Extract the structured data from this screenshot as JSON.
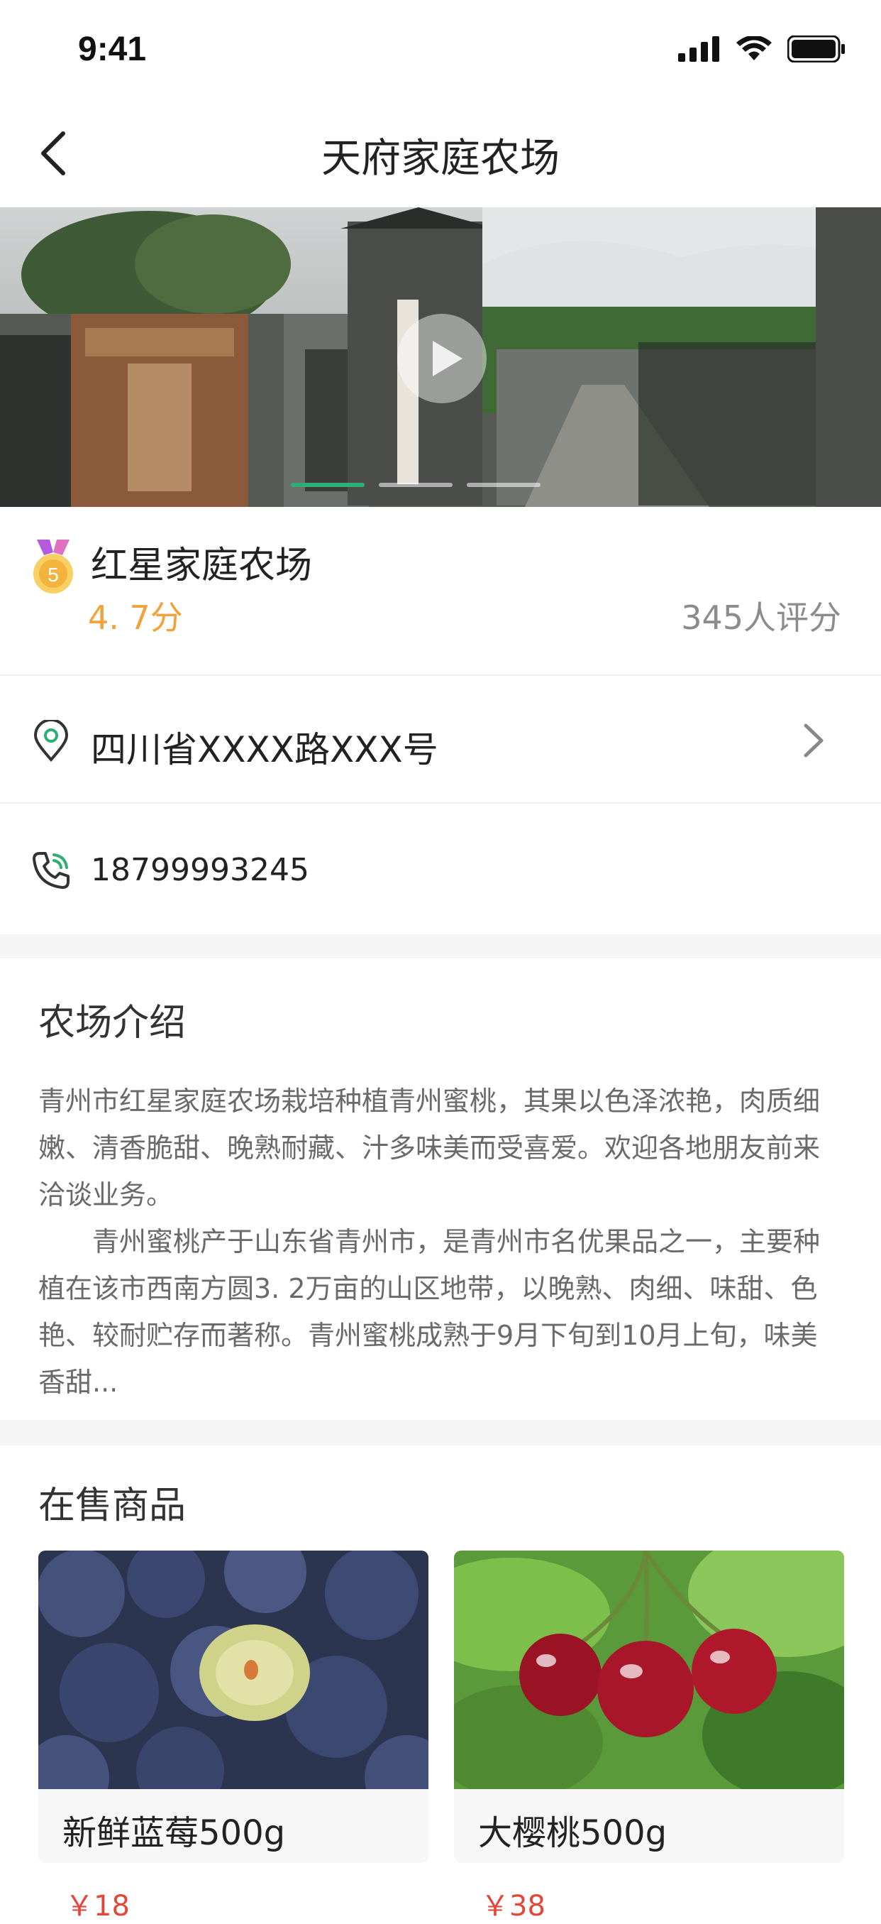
{
  "status_bar": {
    "time": "9:41"
  },
  "nav": {
    "title": "天府家庭农场"
  },
  "banner": {
    "total_slides": 3,
    "active_slide": 1
  },
  "farm": {
    "name": "红星家庭农场",
    "medal_level": "5",
    "rating": "4. 7分",
    "reviews": "345人评分",
    "address": "四川省XXXX路XXX号",
    "phone": "18799993245"
  },
  "intro": {
    "title": "农场介绍",
    "paragraph1": "青州市红星家庭农场栽培种植青州蜜桃，其果以色泽浓艳，肉质细嫩、清香脆甜、晚熟耐藏、汁多味美而受喜爱。欢迎各地朋友前来洽谈业务。",
    "paragraph2": "青州蜜桃产于山东省青州市，是青州市名优果品之一，主要种植在该市西南方圆3. 2万亩的山区地带，以晚熟、肉细、味甜、色艳、较耐贮存而著称。青州蜜桃成熟于9月下旬到10月上旬，味美香甜..."
  },
  "products": {
    "title": "在售商品",
    "items": [
      {
        "name": "新鲜蓝莓500g",
        "price": "￥18",
        "icon": "blueberry-image"
      },
      {
        "name": "大樱桃500g",
        "price": "￥38",
        "icon": "cherry-image"
      }
    ]
  },
  "colors": {
    "accent": "#2fae74",
    "rating": "#f2a23a",
    "price": "#e2483a"
  }
}
